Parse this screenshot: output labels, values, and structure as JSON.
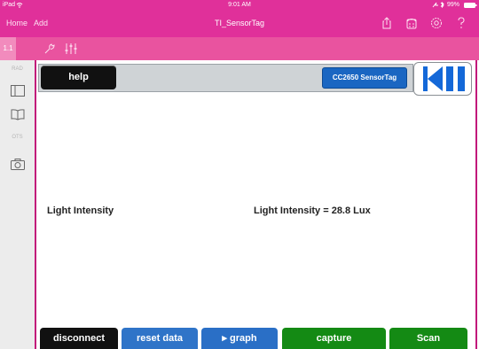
{
  "status_bar": {
    "carrier": "iPad",
    "time": "9:01 AM",
    "battery": "99%"
  },
  "nav": {
    "home": "Home",
    "add": "Add",
    "title": "TI_SensorTag"
  },
  "toolbar": {
    "page_number": "1.1"
  },
  "sidebar": {
    "top_label": "RAD",
    "mid_label": "OTS"
  },
  "header": {
    "help_label": "help",
    "device_label": "CC2650 SensorTag"
  },
  "content": {
    "left_label": "Light Intensity",
    "reading": "Light Intensity = 28.8 Lux"
  },
  "bottom_buttons": {
    "disconnect": "disconnect",
    "reset": "reset data",
    "graph": "▸ graph",
    "capture": "capture",
    "scan": "Scan"
  },
  "colors": {
    "accent": "#e0309a",
    "toolbar": "#e9539f",
    "device_button": "#1a66c2",
    "player_icon": "#1468d8",
    "disconnect": "#111111",
    "reset": "#2f74c8",
    "graph": "#2a6fc6",
    "capture": "#148a14",
    "scan": "#148a14"
  },
  "icons": {
    "nav": [
      "share-icon",
      "remote-icon",
      "settings-icon",
      "help-icon"
    ],
    "toolbar": [
      "wrench-icon",
      "sliders-icon"
    ],
    "sidebar": [
      "panel-icon",
      "book-icon",
      "camera-icon"
    ],
    "player": [
      "skip-back-icon",
      "pause-icon"
    ]
  }
}
